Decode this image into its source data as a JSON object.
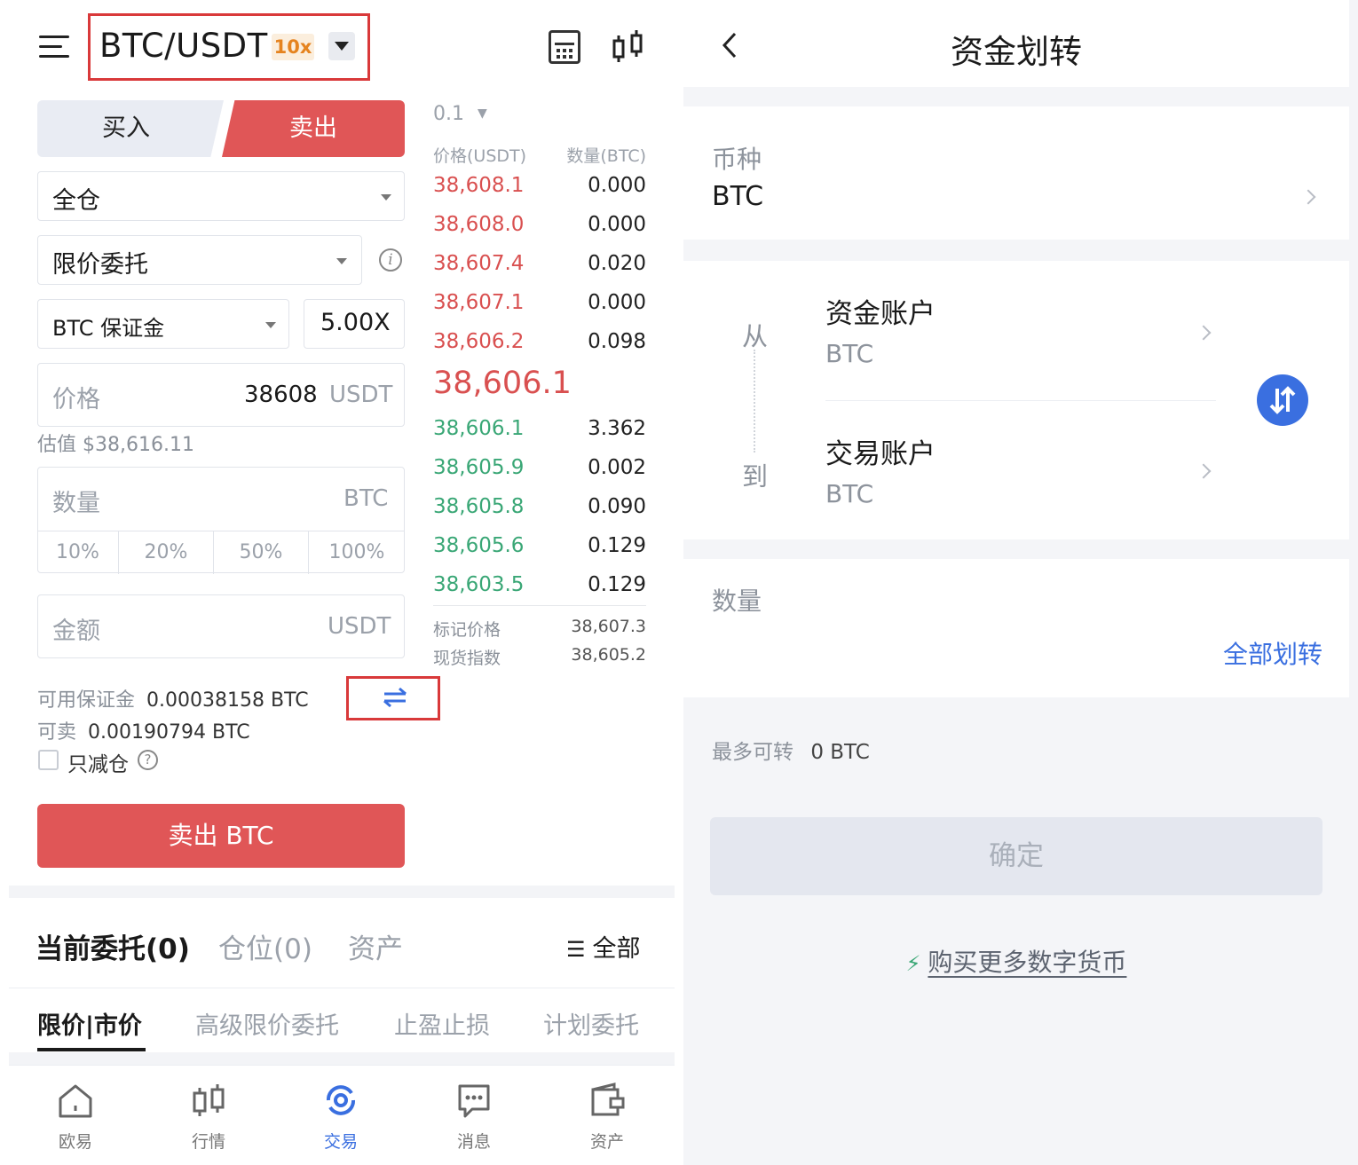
{
  "left": {
    "header": {
      "pair": "BTC/USDT",
      "leverage_badge": "10x"
    },
    "side_tabs": {
      "buy": "买入",
      "sell": "卖出"
    },
    "margin_mode": "全仓",
    "order_type": "限价委托",
    "margin_currency": "BTC 保证金",
    "leverage": "5.00X",
    "price": {
      "label": "价格",
      "value": "38608",
      "unit": "USDT"
    },
    "estimate": "估值 $38,616.11",
    "quantity": {
      "label": "数量",
      "unit": "BTC"
    },
    "percentages": [
      "10%",
      "20%",
      "50%",
      "100%"
    ],
    "amount": {
      "label": "金额",
      "unit": "USDT"
    },
    "available_margin": {
      "label": "可用保证金",
      "value": "0.00038158 BTC"
    },
    "sellable": {
      "label": "可卖",
      "value": "0.00190794 BTC"
    },
    "reduce_only": "只减仓",
    "sell_button": "卖出 BTC",
    "orderbook": {
      "depth": "0.1",
      "header_price": "价格(USDT)",
      "header_qty": "数量(BTC)",
      "asks": [
        {
          "price": "38,608.1",
          "qty": "0.000"
        },
        {
          "price": "38,608.0",
          "qty": "0.000"
        },
        {
          "price": "38,607.4",
          "qty": "0.020"
        },
        {
          "price": "38,607.1",
          "qty": "0.000"
        },
        {
          "price": "38,606.2",
          "qty": "0.098"
        }
      ],
      "last_price": "38,606.1",
      "bids": [
        {
          "price": "38,606.1",
          "qty": "3.362"
        },
        {
          "price": "38,605.9",
          "qty": "0.002"
        },
        {
          "price": "38,605.8",
          "qty": "0.090"
        },
        {
          "price": "38,605.6",
          "qty": "0.129"
        },
        {
          "price": "38,603.5",
          "qty": "0.129"
        }
      ],
      "mark_price_label": "标记价格",
      "mark_price": "38,607.3",
      "index_label": "现货指数",
      "index_price": "38,605.2"
    },
    "order_tabs": {
      "current": "当前委托(0)",
      "positions": "仓位(0)",
      "assets": "资产",
      "all": "全部"
    },
    "sub_tabs": [
      "限价|市价",
      "高级限价委托",
      "止盈止损",
      "计划委托"
    ],
    "bottom_nav": [
      "欧易",
      "行情",
      "交易",
      "消息",
      "资产"
    ]
  },
  "right": {
    "title": "资金划转",
    "currency": {
      "label": "币种",
      "value": "BTC"
    },
    "from": {
      "label": "从",
      "account": "资金账户",
      "currency": "BTC"
    },
    "to": {
      "label": "到",
      "account": "交易账户",
      "currency": "BTC"
    },
    "quantity_label": "数量",
    "transfer_all": "全部划转",
    "max_transfer": {
      "label": "最多可转",
      "value": "0 BTC"
    },
    "confirm": "确定",
    "buy_more": "购买更多数字货币"
  },
  "colors": {
    "sell_red": "#e05657",
    "bid_green": "#3aa776",
    "accent_blue": "#3a6fe0",
    "highlight_box": "#d9393a",
    "leverage_orange": "#e5831f"
  }
}
